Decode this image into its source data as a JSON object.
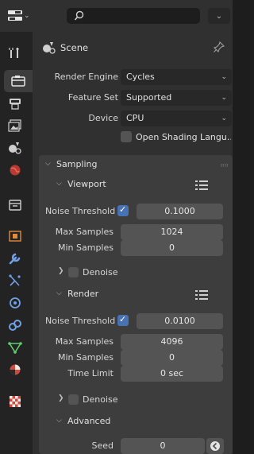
{
  "header": {
    "editor_type_icon": "properties-editor-icon",
    "search_value": "",
    "search_icon": "search-icon"
  },
  "tabs": [
    {
      "name": "tool-tab",
      "icon": "tool-icon"
    },
    {
      "name": "render-tab",
      "icon": "camera-back-icon",
      "active": true
    },
    {
      "name": "output-tab",
      "icon": "printer-icon"
    },
    {
      "name": "view-layer-tab",
      "icon": "image-icon"
    },
    {
      "name": "scene-tab",
      "icon": "scene-icon"
    },
    {
      "name": "world-tab",
      "icon": "world-icon"
    },
    {
      "name": "collection-tab",
      "icon": "collection-icon"
    },
    {
      "name": "object-tab",
      "icon": "object-icon"
    },
    {
      "name": "modifiers-tab",
      "icon": "wrench-icon"
    },
    {
      "name": "particles-tab",
      "icon": "particles-icon"
    },
    {
      "name": "physics-tab",
      "icon": "physics-icon"
    },
    {
      "name": "constraints-tab",
      "icon": "constraint-icon"
    },
    {
      "name": "data-tab",
      "icon": "mesh-data-icon"
    },
    {
      "name": "material-tab",
      "icon": "material-icon"
    },
    {
      "name": "texture-tab",
      "icon": "texture-icon"
    }
  ],
  "context": {
    "label": "Scene",
    "pin_icon": "pin-icon"
  },
  "render": {
    "engine_label": "Render Engine",
    "engine_value": "Cycles",
    "feature_set_label": "Feature Set",
    "feature_set_value": "Supported",
    "device_label": "Device",
    "device_value": "CPU",
    "osl_label": "Open Shading Langu...",
    "osl_checked": false
  },
  "sampling": {
    "title": "Sampling",
    "viewport": {
      "title": "Viewport",
      "noise_threshold_label": "Noise Threshold",
      "noise_threshold_enabled": true,
      "noise_threshold_value": "0.1000",
      "max_samples_label": "Max Samples",
      "max_samples_value": "1024",
      "min_samples_label": "Min Samples",
      "min_samples_value": "0",
      "denoise_label": "Denoise",
      "denoise_checked": false
    },
    "render": {
      "title": "Render",
      "noise_threshold_label": "Noise Threshold",
      "noise_threshold_enabled": true,
      "noise_threshold_value": "0.0100",
      "max_samples_label": "Max Samples",
      "max_samples_value": "4096",
      "min_samples_label": "Min Samples",
      "min_samples_value": "0",
      "time_limit_label": "Time Limit",
      "time_limit_value": "0 sec",
      "denoise_label": "Denoise",
      "denoise_checked": false
    },
    "advanced": {
      "title": "Advanced",
      "seed_label": "Seed",
      "seed_value": "0"
    }
  },
  "colors": {
    "accent": "#4772b3",
    "panel": "#3d3d3d",
    "background": "#303030"
  }
}
